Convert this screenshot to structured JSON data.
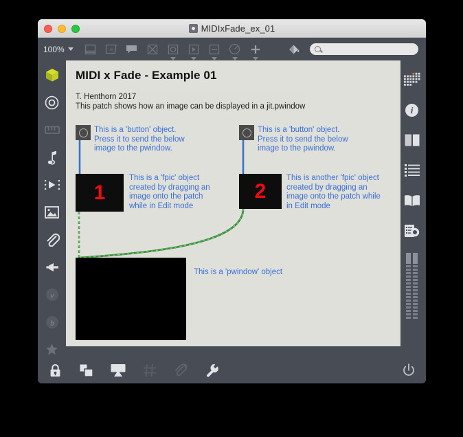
{
  "window": {
    "title": "MIDIxFade_ex_01",
    "title_icon": "record-circle-icon",
    "traffic_lights": [
      "close",
      "minimize",
      "zoom"
    ]
  },
  "toolbar": {
    "zoom_level": "100%",
    "items": [
      {
        "name": "inspector-icon",
        "label": "Inspector",
        "has_caret": false
      },
      {
        "name": "message-box-icon",
        "label": "Message",
        "has_caret": false
      },
      {
        "name": "comment-icon",
        "label": "Comment",
        "has_caret": false
      },
      {
        "name": "toggle-icon",
        "label": "Toggle",
        "has_caret": false
      },
      {
        "name": "button-icon",
        "label": "Button",
        "has_caret": true
      },
      {
        "name": "playbar-icon",
        "label": "Playbar",
        "has_caret": true
      },
      {
        "name": "slider-icon",
        "label": "Slider",
        "has_caret": true
      },
      {
        "name": "dial-icon",
        "label": "Dial",
        "has_caret": true
      },
      {
        "name": "plus-icon",
        "label": "Add Object",
        "has_caret": true
      },
      {
        "name": "paint-bucket-icon",
        "label": "Palette",
        "has_caret": false
      }
    ],
    "search": {
      "placeholder": "",
      "value": "",
      "icon": "search-icon"
    }
  },
  "left_rail": {
    "items": [
      {
        "name": "sidebar-max-object-icon",
        "label": "Max Objects",
        "active": true
      },
      {
        "name": "sidebar-target-icon",
        "label": "Target",
        "active": false
      },
      {
        "name": "sidebar-keyboard-icon",
        "label": "Keyboard",
        "active": false
      },
      {
        "name": "sidebar-music-note-icon",
        "label": "Audio",
        "active": false
      },
      {
        "name": "sidebar-video-icon",
        "label": "Video / Jitter",
        "active": false
      },
      {
        "name": "sidebar-image-icon",
        "label": "Images",
        "active": false
      },
      {
        "name": "sidebar-paperclip-icon",
        "label": "Attachments",
        "active": false
      },
      {
        "name": "sidebar-plug-icon",
        "label": "Devices",
        "active": false
      },
      {
        "name": "sidebar-vizzie-icon",
        "label": "Vizzie",
        "active": false
      },
      {
        "name": "sidebar-bach-icon",
        "label": "BEAP",
        "active": false
      },
      {
        "name": "sidebar-favorites-icon",
        "label": "Favorites",
        "active": false
      }
    ]
  },
  "right_rail": {
    "items": [
      {
        "name": "pattern-grid-icon",
        "label": "Snippets"
      },
      {
        "name": "info-icon",
        "label": "Info"
      },
      {
        "name": "panels-icon",
        "label": "Panels"
      },
      {
        "name": "list-icon",
        "label": "Parameters"
      },
      {
        "name": "book-icon",
        "label": "Reference"
      },
      {
        "name": "console-icon",
        "label": "Max Console"
      },
      {
        "name": "level-meters-icon",
        "label": "Audio Meters"
      }
    ]
  },
  "bottom_bar": {
    "items": [
      {
        "name": "lock-icon",
        "label": "Lock / Edit Mode",
        "enabled": true
      },
      {
        "name": "presentation-copy-icon",
        "label": "Presentation Mode",
        "enabled": true
      },
      {
        "name": "screen-icon",
        "label": "Open Window",
        "enabled": true
      },
      {
        "name": "grid-icon",
        "label": "Snap to Grid",
        "enabled": false
      },
      {
        "name": "add-attachment-icon",
        "label": "Add Dependency",
        "enabled": false
      },
      {
        "name": "wrench-icon",
        "label": "Patcher Inspector",
        "enabled": true
      }
    ],
    "right_items": [
      {
        "name": "power-icon",
        "label": "Audio On/Off",
        "enabled": true
      }
    ]
  },
  "patch": {
    "title": "MIDI x Fade - Example 01",
    "header_note_line1": "T. Henthorn 2017",
    "header_note_line2": "This patch shows how an image can be displayed in a jit.pwindow",
    "objects": [
      {
        "name": "button-object-1",
        "type": "button",
        "comment": "This is a 'button' object.\nPress it to send the below\nimage to the pwindow."
      },
      {
        "name": "button-object-2",
        "type": "button",
        "comment": "This is a 'button' object.\nPress it to send the below\nimage to the pwindow."
      },
      {
        "name": "fpic-object-1",
        "type": "fpic",
        "image_label": "1",
        "comment": "This is a 'fpic' object\ncreated by dragging an\nimage onto the patch\nwhile in Edit mode"
      },
      {
        "name": "fpic-object-2",
        "type": "fpic",
        "image_label": "2",
        "comment": "This is another 'fpic' object\ncreated by dragging an\nimage onto the patch while\nin Edit mode"
      },
      {
        "name": "pwindow-object",
        "type": "jit.pwindow",
        "comment": "This is a 'pwindow' object"
      }
    ],
    "colors": {
      "canvas_bg": "#e0e0da",
      "comment_text": "#3a6fd8",
      "object_fill": "#0d0d0d",
      "fpic_number": "#f00c0c",
      "signal_cord": "#4a9e4a",
      "message_cord": "#4a7fd8",
      "chrome": "#474c55"
    }
  }
}
